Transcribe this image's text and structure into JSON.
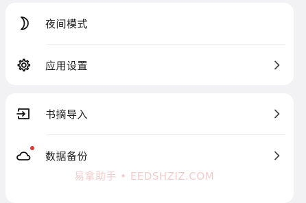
{
  "section1": {
    "items": [
      {
        "label": "夜间模式",
        "icon": "moon-icon"
      },
      {
        "label": "应用设置",
        "icon": "gear-icon"
      }
    ]
  },
  "section2": {
    "items": [
      {
        "label": "书摘导入",
        "icon": "import-icon"
      },
      {
        "label": "数据备份",
        "icon": "cloud-icon"
      }
    ]
  },
  "watermark": "易拿助手 • EEDSHZIZ.COM",
  "colors": {
    "background": "#f2f2f4",
    "card": "#ffffff",
    "badge": "#e53935",
    "text": "#1c1c1c"
  }
}
